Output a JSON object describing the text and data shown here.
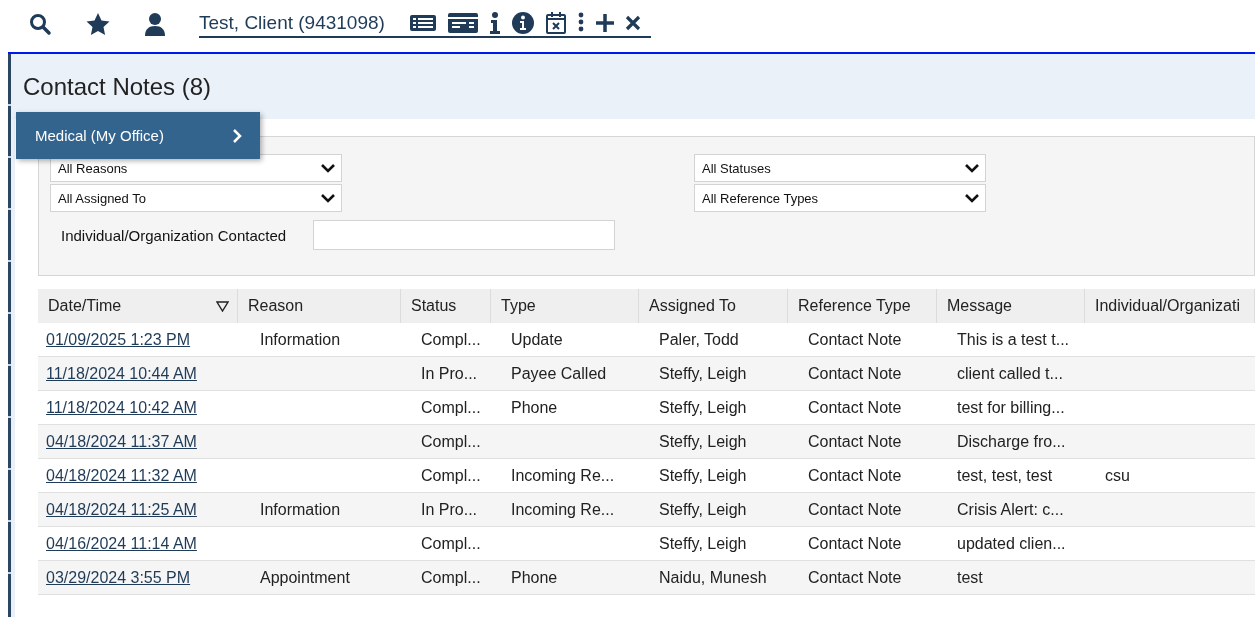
{
  "toolbar": {
    "client_name": "Test, Client (9431098)"
  },
  "page": {
    "title": "Contact Notes (8)"
  },
  "menu": {
    "items": [
      {
        "label": "Medical (My Office)"
      }
    ]
  },
  "filters": {
    "left": [
      {
        "value": "All Reasons"
      },
      {
        "value": "All Assigned To"
      }
    ],
    "right": [
      {
        "value": "All Statuses"
      },
      {
        "value": "All Reference Types"
      }
    ],
    "contacted": {
      "label": "Individual/Organization Contacted"
    }
  },
  "table": {
    "columns": [
      {
        "label": "Date/Time",
        "sorted": true
      },
      {
        "label": "Reason",
        "sorted": false
      },
      {
        "label": "Status",
        "sorted": false
      },
      {
        "label": "Type",
        "sorted": false
      },
      {
        "label": "Assigned To",
        "sorted": false
      },
      {
        "label": "Reference Type",
        "sorted": false
      },
      {
        "label": "Message",
        "sorted": false
      },
      {
        "label": "Individual/Organizati",
        "sorted": false
      }
    ],
    "rows": [
      {
        "date": "01/09/2025 1:23 PM",
        "reason": "Information",
        "status": "Compl...",
        "type": "Update",
        "assigned": "Paler, Todd",
        "reference": "Contact Note",
        "message": "This is a test t...",
        "contacted": ""
      },
      {
        "date": "11/18/2024 10:44 AM",
        "reason": "",
        "status": "In Pro...",
        "type": "Payee Called",
        "assigned": "Steffy, Leigh",
        "reference": "Contact Note",
        "message": "client called t...",
        "contacted": ""
      },
      {
        "date": "11/18/2024 10:42 AM",
        "reason": "",
        "status": "Compl...",
        "type": "Phone",
        "assigned": "Steffy, Leigh",
        "reference": "Contact Note",
        "message": "test for billing...",
        "contacted": ""
      },
      {
        "date": "04/18/2024 11:37 AM",
        "reason": "",
        "status": "Compl...",
        "type": "",
        "assigned": "Steffy, Leigh",
        "reference": "Contact Note",
        "message": "Discharge fro...",
        "contacted": ""
      },
      {
        "date": "04/18/2024 11:32 AM",
        "reason": "",
        "status": "Compl...",
        "type": "Incoming Re...",
        "assigned": "Steffy, Leigh",
        "reference": "Contact Note",
        "message": "test, test, test",
        "contacted": "csu"
      },
      {
        "date": "04/18/2024 11:25 AM",
        "reason": "Information",
        "status": "In Pro...",
        "type": "Incoming Re...",
        "assigned": "Steffy, Leigh",
        "reference": "Contact Note",
        "message": "Crisis Alert: c...",
        "contacted": ""
      },
      {
        "date": "04/16/2024 11:14 AM",
        "reason": "",
        "status": "Compl...",
        "type": "",
        "assigned": "Steffy, Leigh",
        "reference": "Contact Note",
        "message": "updated clien...",
        "contacted": ""
      },
      {
        "date": "03/29/2024 3:55 PM",
        "reason": "Appointment",
        "status": "Compl...",
        "type": "Phone",
        "assigned": "Naidu, Munesh",
        "reference": "Contact Note",
        "message": "test",
        "contacted": ""
      }
    ]
  }
}
